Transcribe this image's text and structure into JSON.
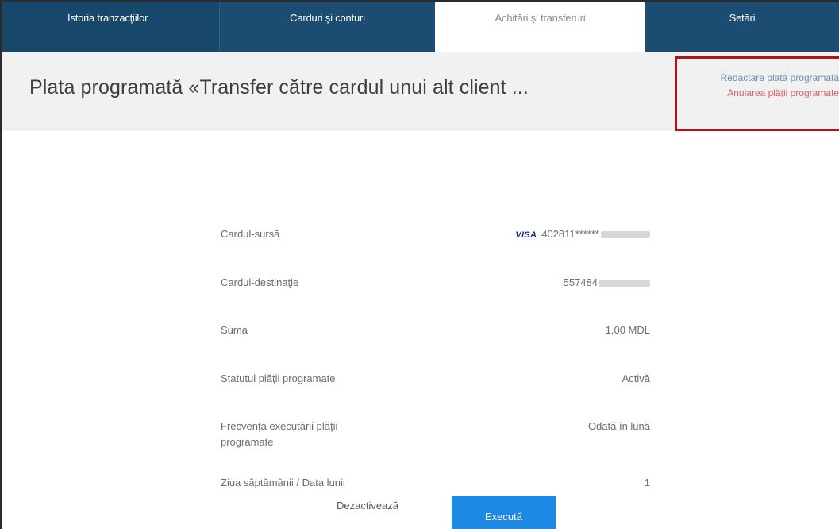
{
  "nav": {
    "tabs": [
      {
        "label": "Istoria tranzacţiilor",
        "active": false
      },
      {
        "label": "Carduri şi conturi",
        "active": false
      },
      {
        "label": "Achitări şi transferuri",
        "active": true
      },
      {
        "label": "Setări",
        "active": false
      }
    ]
  },
  "header": {
    "title": "Plata programată «Transfer către cardul unui alt client ...",
    "edit_link": "Redactare plată programată",
    "cancel_link": "Anularea plăţii programate"
  },
  "details": {
    "source_card": {
      "label": "Cardul-sursă",
      "brand": "VISA",
      "value": "402811******"
    },
    "dest_card": {
      "label": "Cardul-destinaţie",
      "value": "557484"
    },
    "amount": {
      "label": "Suma",
      "value": "1,00 MDL"
    },
    "status": {
      "label": "Statutul plăţii programate",
      "value": "Activă"
    },
    "frequency": {
      "label": "Frecvenţa executării plăţii programate",
      "value": "Odată în lună"
    },
    "day": {
      "label": "Ziua săptămânii / Data lunii",
      "value": "1"
    }
  },
  "buttons": {
    "deactivate": "Dezactivează",
    "execute": "Execută"
  },
  "colors": {
    "nav_bg": "#17486b",
    "accent_button": "#1e88e5",
    "highlight_border": "#b0141a",
    "cancel_link": "#e05a5f",
    "edit_link": "#6b8fb8"
  }
}
